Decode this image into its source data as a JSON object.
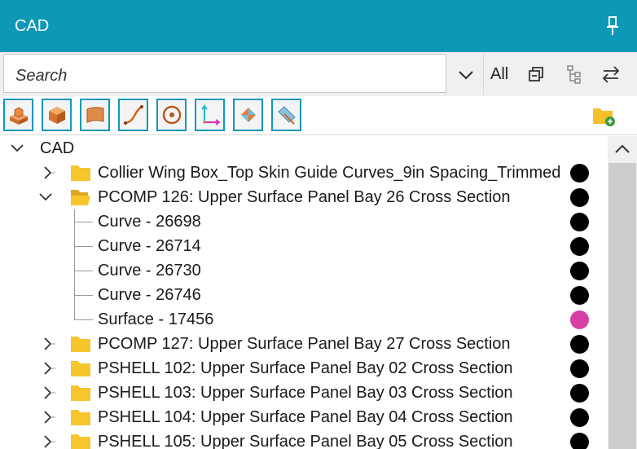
{
  "panel": {
    "title": "CAD"
  },
  "search": {
    "placeholder": "Search",
    "filter_label": "All"
  },
  "colors": {
    "titlebar": "#0e98b8",
    "accent_border": "#0e98b8",
    "surface_dot": "#d63fa4",
    "default_dot": "#000000"
  },
  "toolbar_icons": [
    "solid-extrude-icon",
    "solid-box-icon",
    "surface-icon",
    "curve-icon",
    "point-icon",
    "axis-system-icon",
    "transform-icon",
    "plane-icon"
  ],
  "tree": {
    "root": {
      "label": "CAD"
    },
    "items": [
      {
        "label": "Collier Wing Box_Top Skin Guide Curves_9in Spacing_Trimmed"
      },
      {
        "label": "PCOMP 126: Upper Surface Panel Bay 26 Cross Section"
      },
      {
        "label": "Curve - 26698"
      },
      {
        "label": "Curve - 26714"
      },
      {
        "label": "Curve - 26730"
      },
      {
        "label": "Curve - 26746"
      },
      {
        "label": "Surface - 17456"
      },
      {
        "label": "PCOMP 127: Upper Surface Panel Bay 27 Cross Section"
      },
      {
        "label": "PSHELL 102: Upper Surface Panel Bay 02 Cross Section"
      },
      {
        "label": "PSHELL 103: Upper Surface Panel Bay 03 Cross Section"
      },
      {
        "label": "PSHELL 104: Upper Surface Panel Bay 04 Cross Section"
      },
      {
        "label": "PSHELL 105: Upper Surface Panel Bay 05 Cross Section"
      }
    ]
  }
}
